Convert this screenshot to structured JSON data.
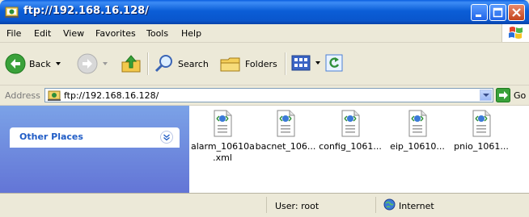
{
  "window": {
    "title": "ftp://192.168.16.128/"
  },
  "menu": {
    "file": "File",
    "edit": "Edit",
    "view": "View",
    "favorites": "Favorites",
    "tools": "Tools",
    "help": "Help"
  },
  "toolbar": {
    "back": "Back",
    "search": "Search",
    "folders": "Folders"
  },
  "address": {
    "label": "Address",
    "value": "ftp://192.168.16.128/",
    "go": "Go"
  },
  "task_pane": {
    "other_places": "Other Places"
  },
  "files": [
    {
      "name": "alarm_10610a",
      "name2": ".xml",
      "icon": "xml-file-icon"
    },
    {
      "name": "bacnet_106...",
      "name2": "",
      "icon": "xml-file-icon"
    },
    {
      "name": "config_1061...",
      "name2": "",
      "icon": "xml-file-icon"
    },
    {
      "name": "eip_10610...",
      "name2": "",
      "icon": "xml-file-icon"
    },
    {
      "name": "pnio_1061...",
      "name2": "",
      "icon": "xml-file-icon"
    }
  ],
  "status": {
    "user": "User: root",
    "zone": "Internet"
  },
  "colors": {
    "titlebar": "#0b5ed7",
    "pane": "#6f8fe0",
    "link": "#215dc6"
  }
}
